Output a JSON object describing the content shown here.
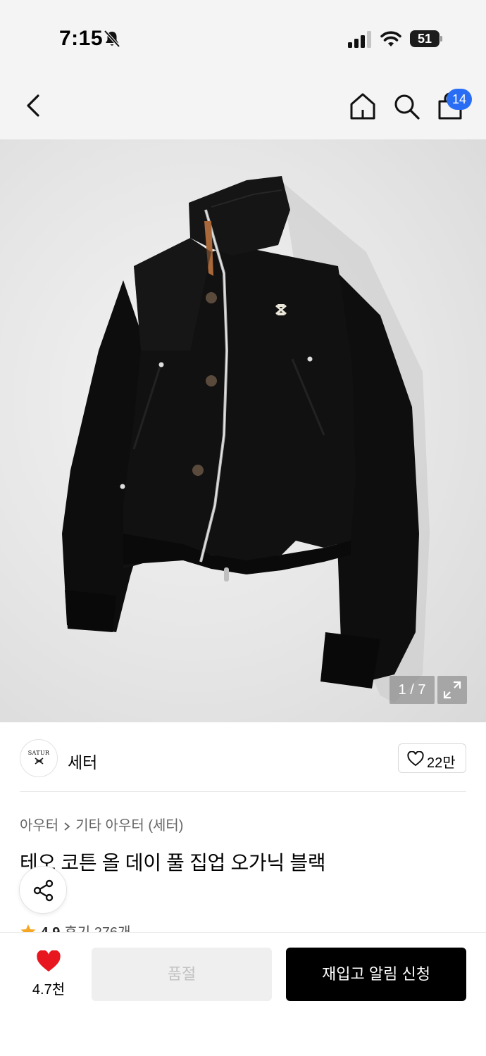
{
  "status_bar": {
    "time": "7:15",
    "battery": "51",
    "icons": [
      "bell-muted-icon",
      "cellular-signal-icon",
      "wifi-icon",
      "battery-icon"
    ]
  },
  "nav": {
    "back_icon": "chevron-left-icon",
    "home_icon": "home-icon",
    "search_icon": "search-icon",
    "cart_icon": "shopping-bag-icon",
    "cart_badge": "14",
    "badge_color": "#2a6df5"
  },
  "gallery": {
    "counter": "1 / 7",
    "expand_icon": "expand-icon"
  },
  "brand": {
    "logo_text": "SATUR",
    "name": "세터",
    "like_icon": "heart-outline-icon",
    "like_count": "22만"
  },
  "product": {
    "breadcrumb": [
      "아우터",
      "기타 아우터 (세터)"
    ],
    "title": "테오 코튼 올 데이 풀 집업 오가닉 블랙",
    "share_icon": "share-icon",
    "rating": "4.9",
    "reviews": "후기 276개"
  },
  "bottom_bar": {
    "wish_icon": "heart-filled-icon",
    "wish_color": "#e8161e",
    "wish_count": "4.7천",
    "soldout_label": "품절",
    "restock_label": "재입고 알림 신청"
  }
}
